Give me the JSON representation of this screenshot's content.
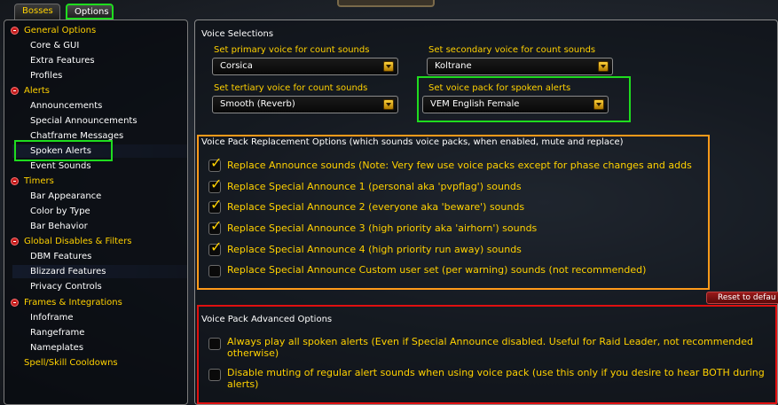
{
  "tabs": {
    "bosses": "Bosses",
    "options": "Options"
  },
  "tree": [
    {
      "label": "General Options",
      "type": "cat"
    },
    {
      "label": "Core & GUI",
      "type": "sub"
    },
    {
      "label": "Extra Features",
      "type": "sub"
    },
    {
      "label": "Profiles",
      "type": "sub"
    },
    {
      "label": "Alerts",
      "type": "cat"
    },
    {
      "label": "Announcements",
      "type": "sub"
    },
    {
      "label": "Special Announcements",
      "type": "sub"
    },
    {
      "label": "Chatframe Messages",
      "type": "sub"
    },
    {
      "label": "Spoken Alerts",
      "type": "sub"
    },
    {
      "label": "Event Sounds",
      "type": "sub"
    },
    {
      "label": "Timers",
      "type": "cat"
    },
    {
      "label": "Bar Appearance",
      "type": "sub"
    },
    {
      "label": "Color by Type",
      "type": "sub"
    },
    {
      "label": "Bar Behavior",
      "type": "sub"
    },
    {
      "label": "Global Disables & Filters",
      "type": "cat"
    },
    {
      "label": "DBM Features",
      "type": "sub"
    },
    {
      "label": "Blizzard Features",
      "type": "sub"
    },
    {
      "label": "Privacy Controls",
      "type": "sub"
    },
    {
      "label": "Frames & Integrations",
      "type": "cat"
    },
    {
      "label": "Infoframe",
      "type": "sub"
    },
    {
      "label": "Rangeframe",
      "type": "sub"
    },
    {
      "label": "Nameplates",
      "type": "sub"
    },
    {
      "label": "Spell/Skill Cooldowns",
      "type": "cat"
    }
  ],
  "voice_selections": {
    "title": "Voice Selections",
    "primary_label": "Set primary voice for count sounds",
    "primary_value": "Corsica",
    "secondary_label": "Set secondary voice for count sounds",
    "secondary_value": "Koltrane",
    "tertiary_label": "Set tertiary voice for count sounds",
    "tertiary_value": "Smooth (Reverb)",
    "pack_label": "Set voice pack for spoken alerts",
    "pack_value": "VEM English Female"
  },
  "replacement": {
    "title": "Voice Pack Replacement Options (which sounds voice packs, when enabled, mute and replace)",
    "options": [
      {
        "label": "Replace Announce sounds (Note: Very few use voice packs except for phase changes and adds",
        "checked": true
      },
      {
        "label": "Replace Special Announce 1 (personal aka 'pvpflag') sounds",
        "checked": true
      },
      {
        "label": "Replace Special Announce 2 (everyone aka 'beware') sounds",
        "checked": true
      },
      {
        "label": "Replace Special Announce 3 (high priority aka 'airhorn') sounds",
        "checked": true
      },
      {
        "label": "Replace Special Announce 4 (high priority run away) sounds",
        "checked": true
      },
      {
        "label": "Replace Special Announce Custom user set (per warning) sounds (not recommended)",
        "checked": false
      }
    ]
  },
  "reset_label": "Reset to defau",
  "advanced": {
    "title": "Voice Pack Advanced Options",
    "options": [
      {
        "label": "Always play all spoken alerts (Even if Special Announce disabled. Useful for Raid Leader, not recommended otherwise)",
        "checked": false
      },
      {
        "label": "Disable muting of regular alert sounds when using voice pack (use this only if you desire to hear BOTH during alerts)",
        "checked": false
      }
    ]
  }
}
